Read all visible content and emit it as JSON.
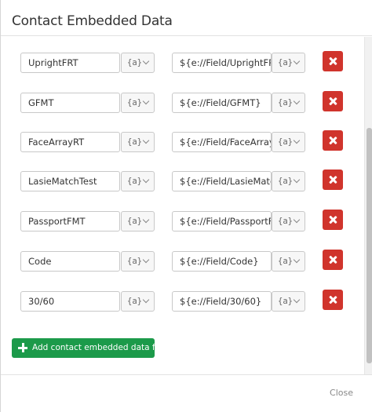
{
  "modal": {
    "title": "Contact Embedded Data",
    "close_label": "Close"
  },
  "rows": [
    {
      "key": "UprightFRT",
      "value": "${e://Field/UprightFRT}",
      "key_piped": "{a}",
      "value_piped": "{a}"
    },
    {
      "key": "GFMT",
      "value": "${e://Field/GFMT}",
      "key_piped": "{a}",
      "value_piped": "{a}"
    },
    {
      "key": "FaceArrayRT",
      "value": "${e://Field/FaceArrayRT}",
      "key_piped": "{a}",
      "value_piped": "{a}"
    },
    {
      "key": "LasieMatchTest",
      "value": "${e://Field/LasieMatchTe",
      "key_piped": "{a}",
      "value_piped": "{a}"
    },
    {
      "key": "PassportFMT",
      "value": "${e://Field/PassportFMT",
      "key_piped": "{a}",
      "value_piped": "{a}"
    },
    {
      "key": "Code",
      "value": "${e://Field/Code}",
      "key_piped": "{a}",
      "value_piped": "{a}"
    },
    {
      "key": "30/60",
      "value": "${e://Field/30/60}",
      "key_piped": "{a}",
      "value_piped": "{a}"
    }
  ],
  "add_button": {
    "label": "Add contact embedded data field"
  },
  "colors": {
    "delete": "#d0342c",
    "add": "#1c9a4a"
  },
  "icons": {
    "delete": "x-icon",
    "add": "plus-icon",
    "dropdown": "chevron-down-icon"
  }
}
